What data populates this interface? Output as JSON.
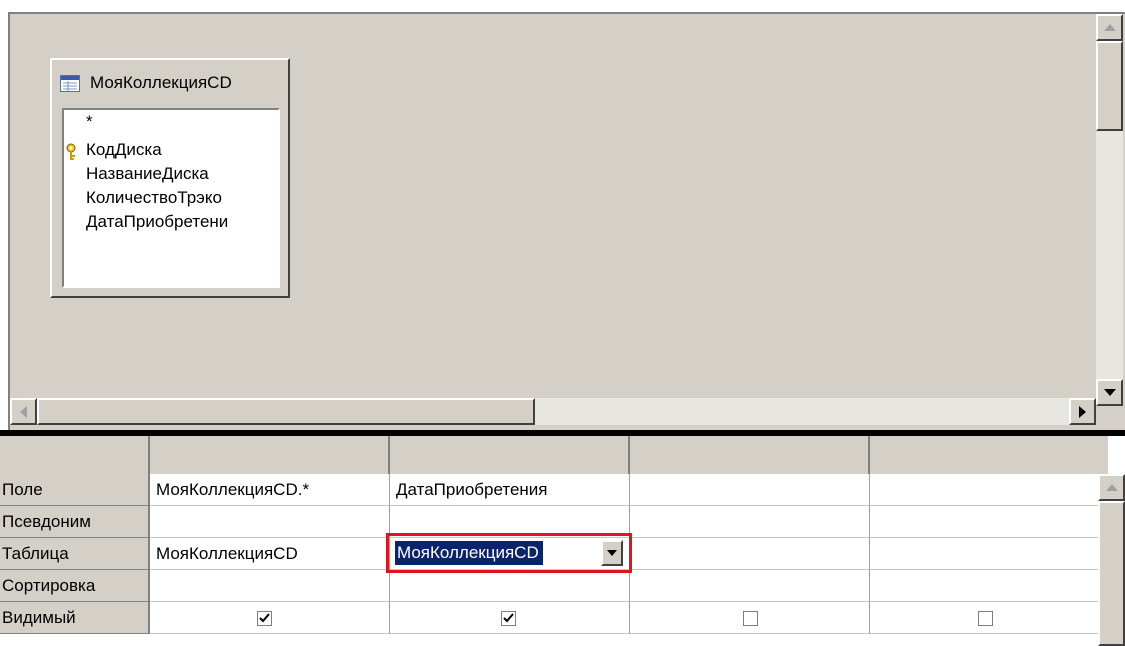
{
  "field_list": {
    "title": "МояКоллекцияCD",
    "fields": [
      {
        "label": "*",
        "is_key": false
      },
      {
        "label": "КодДиска",
        "is_key": true
      },
      {
        "label": "НазваниеДиска",
        "is_key": false
      },
      {
        "label": "КоличествоТрэко",
        "is_key": false
      },
      {
        "label": "ДатаПриобретени",
        "is_key": false
      }
    ]
  },
  "grid": {
    "row_labels": {
      "field": "Поле",
      "alias": "Псевдоним",
      "table": "Таблица",
      "sort": "Сортировка",
      "visible": "Видимый"
    },
    "columns": [
      {
        "field": "МояКоллекцияCD.*",
        "alias": "",
        "table": "МояКоллекцияCD",
        "sort": "",
        "visible": true
      },
      {
        "field": "ДатаПриобретения",
        "alias": "",
        "table": "МояКоллекцияCD",
        "sort": "",
        "visible": true,
        "table_dropdown_open": true
      },
      {
        "field": "",
        "alias": "",
        "table": "",
        "sort": "",
        "visible": false
      },
      {
        "field": "",
        "alias": "",
        "table": "",
        "sort": "",
        "visible": false
      }
    ]
  },
  "colors": {
    "window_bg": "#d4d0c8",
    "selection": "#0a246a",
    "highlight_frame": "#e0141e"
  },
  "icons": {
    "table": "table-icon",
    "primary_key": "key-icon",
    "checked": "checkbox-checked-icon",
    "unchecked": "checkbox-unchecked-icon"
  }
}
